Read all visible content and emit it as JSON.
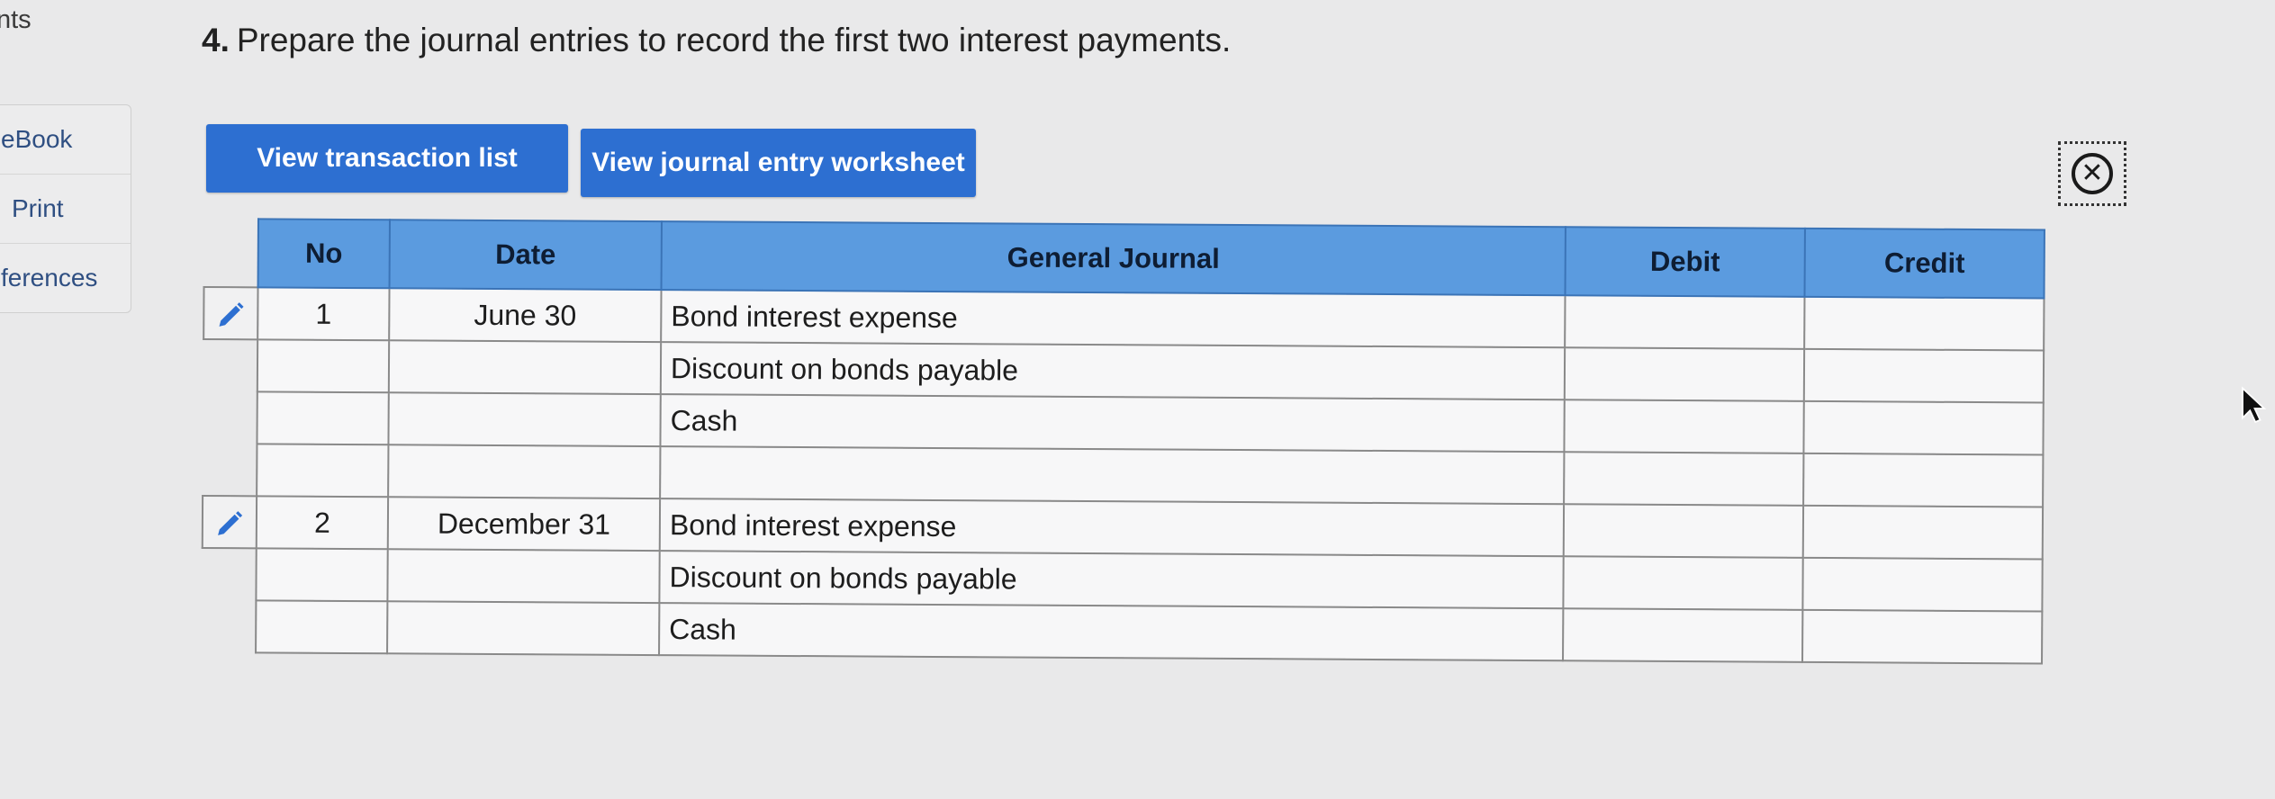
{
  "sidebar": {
    "top_label": "nts",
    "items": [
      {
        "label": "eBook"
      },
      {
        "label": "Print"
      },
      {
        "label": "ferences"
      }
    ]
  },
  "question": {
    "number": "4.",
    "text": "Prepare the journal entries to record the first two interest payments."
  },
  "buttons": {
    "transaction_list": "View transaction list",
    "journal_worksheet": "View journal entry worksheet"
  },
  "journal": {
    "headers": {
      "no": "No",
      "date": "Date",
      "general_journal": "General Journal",
      "debit": "Debit",
      "credit": "Credit"
    },
    "rows": [
      {
        "no": "1",
        "date": "June 30",
        "account": "Bond interest expense",
        "debit": "",
        "credit": ""
      },
      {
        "no": "",
        "date": "",
        "account": "Discount on bonds payable",
        "debit": "",
        "credit": ""
      },
      {
        "no": "",
        "date": "",
        "account": "Cash",
        "debit": "",
        "credit": ""
      },
      {
        "no": "",
        "date": "",
        "account": "",
        "debit": "",
        "credit": ""
      },
      {
        "no": "2",
        "date": "December 31",
        "account": "Bond interest expense",
        "debit": "",
        "credit": ""
      },
      {
        "no": "",
        "date": "",
        "account": "Discount on bonds payable",
        "debit": "",
        "credit": ""
      },
      {
        "no": "",
        "date": "",
        "account": "Cash",
        "debit": "",
        "credit": ""
      }
    ]
  },
  "colors": {
    "button_blue": "#2d6fd1",
    "header_blue": "#5b9bdf",
    "background": "#e9e9ea"
  },
  "icons": {
    "edit": "pencil-icon",
    "close": "close-circle-icon",
    "cursor": "mouse-pointer-icon"
  }
}
